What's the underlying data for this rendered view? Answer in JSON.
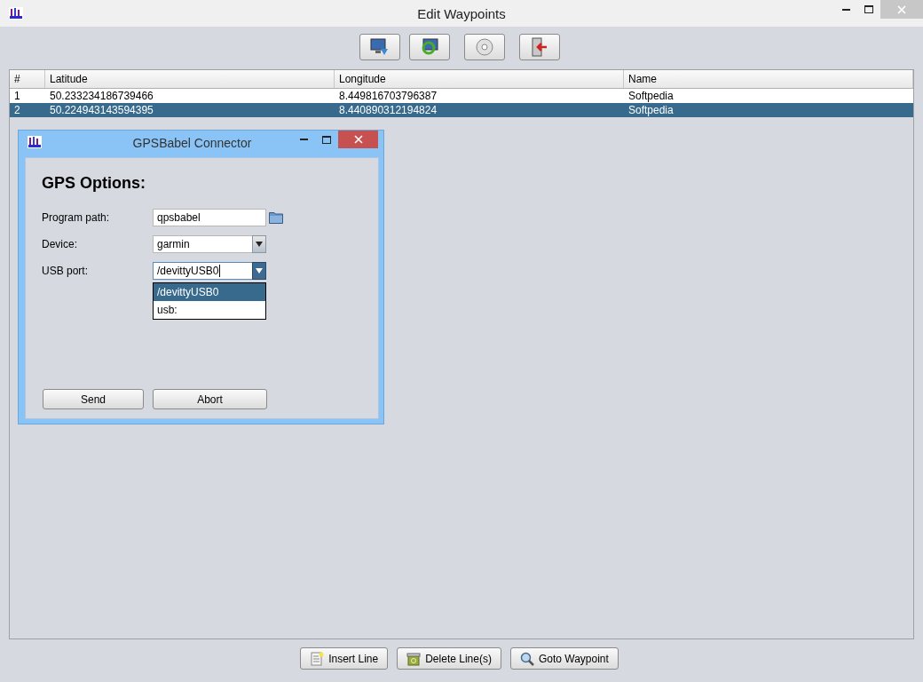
{
  "window": {
    "title": "Edit Waypoints"
  },
  "table": {
    "columns": [
      "#",
      "Latitude",
      "Longitude",
      "Name"
    ],
    "rows": [
      {
        "cells": [
          "1",
          "50.233234186739466",
          "8.449816703796387",
          "Softpedia"
        ],
        "selected": false
      },
      {
        "cells": [
          "2",
          "50.224943143594395",
          "8.440890312194824",
          "Softpedia"
        ],
        "selected": true
      }
    ]
  },
  "dialog": {
    "title": "GPSBabel Connector",
    "heading": "GPS Options:",
    "fields": [
      {
        "kind": "path",
        "label": "Program path:",
        "value": "qpsbabel",
        "focused": false
      },
      {
        "kind": "combo",
        "label": "Device:",
        "value": "garmin",
        "focused": false
      },
      {
        "kind": "combo",
        "label": "USB port:",
        "value": "/devittyUSB0",
        "focused": true
      }
    ],
    "dropdown": [
      {
        "label": "/devittyUSB0",
        "selected": true
      },
      {
        "label": "usb:",
        "selected": false
      }
    ],
    "buttons": [
      "Send",
      "Abort"
    ]
  },
  "bottom_buttons": [
    {
      "kind": "insert",
      "label": "Insert Line"
    },
    {
      "kind": "delete",
      "label": "Delete Line(s)"
    },
    {
      "kind": "goto",
      "label": "Goto Waypoint"
    }
  ]
}
